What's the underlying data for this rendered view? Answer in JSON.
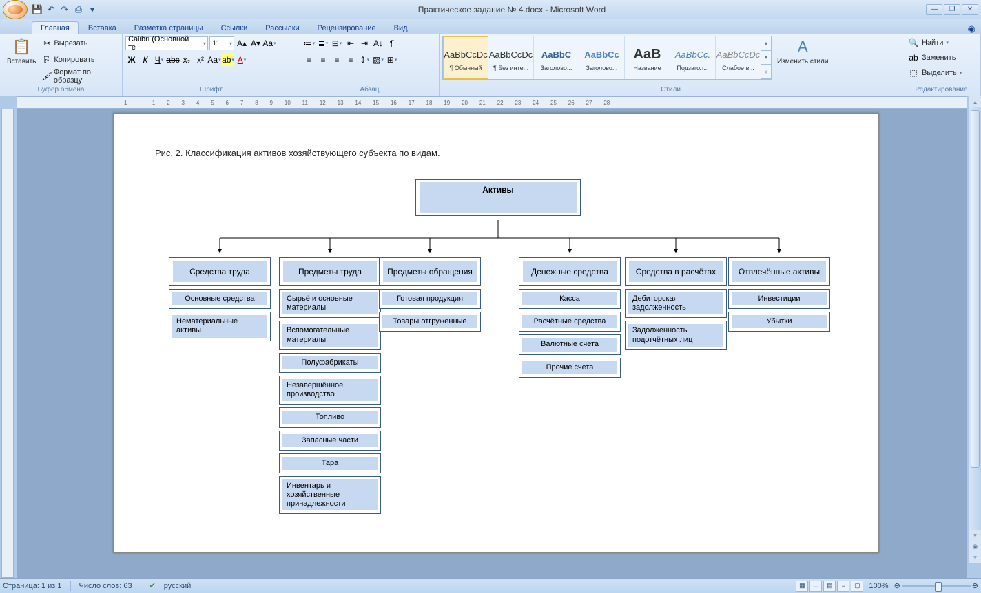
{
  "window": {
    "title": "Практическое задание № 4.docx - Microsoft Word"
  },
  "tabs": {
    "home": "Главная",
    "insert": "Вставка",
    "layout": "Разметка страницы",
    "refs": "Ссылки",
    "mail": "Рассылки",
    "review": "Рецензирование",
    "view": "Вид"
  },
  "clipboard": {
    "paste": "Вставить",
    "cut": "Вырезать",
    "copy": "Копировать",
    "painter": "Формат по образцу",
    "group": "Буфер обмена"
  },
  "font": {
    "name": "Calibri (Основной те",
    "size": "11",
    "group": "Шрифт"
  },
  "para": {
    "group": "Абзац"
  },
  "styles": {
    "group": "Стили",
    "change": "Изменить стили",
    "items": [
      {
        "prev": "AaBbCcDc",
        "name": "¶ Обычный"
      },
      {
        "prev": "AaBbCcDc",
        "name": "¶ Без инте..."
      },
      {
        "prev": "AaBbC",
        "name": "Заголово..."
      },
      {
        "prev": "AaBbCc",
        "name": "Заголово..."
      },
      {
        "prev": "AaB",
        "name": "Название"
      },
      {
        "prev": "AaBbCc.",
        "name": "Подзагол..."
      },
      {
        "prev": "AaBbCcDc",
        "name": "Слабое в..."
      }
    ]
  },
  "edit": {
    "group": "Редактирование",
    "find": "Найти",
    "replace": "Заменить",
    "select": "Выделить"
  },
  "ruler": "1 · · · · · · · 1 · · · 2 · · · 3 · · · 4 · · · 5 · · · 6 · · · 7 · · · 8 · · · 9 · · · 10 · · · 11 · · · 12 · · · 13 · · · 14 · · · 15 · · · 16 · · · 17 · · · 18 · · · 19 · · · 20 · · · 21 · · · 22 · · · 23 · · · 24 · · · 25 · · · 26 · · · 27 · · · 28",
  "doc": {
    "caption": "Рис. 2. Классификация активов хозяйствующего субъекта по видам.",
    "top": "Активы",
    "cols": [
      {
        "head": "Средства труда",
        "items": [
          "Основные средства",
          "Нематериальные активы"
        ]
      },
      {
        "head": "Предметы труда",
        "items": [
          "Сырьё и основные материалы",
          "Вспомогательные материалы",
          "Полуфабрикаты",
          "Незавершённое производство",
          "Топливо",
          "Запасные части",
          "Тара",
          "Инвентарь и хозяйственные принадлежности"
        ]
      },
      {
        "head": "Предметы обращения",
        "items": [
          "Готовая продукция",
          "Товары отгруженные"
        ]
      },
      {
        "head": "Денежные средства",
        "items": [
          "Касса",
          "Расчётные средства",
          "Валютные счета",
          "Прочие счета"
        ]
      },
      {
        "head": "Средства в расчётах",
        "items": [
          "Дебиторская задолженность",
          "Задолженность подотчётных лиц"
        ]
      },
      {
        "head": "Отвлечённые активы",
        "items": [
          "Инвестиции",
          "Убытки"
        ]
      }
    ]
  },
  "status": {
    "page": "Страница: 1 из 1",
    "words": "Число слов: 63",
    "lang": "русский",
    "zoom": "100%"
  }
}
